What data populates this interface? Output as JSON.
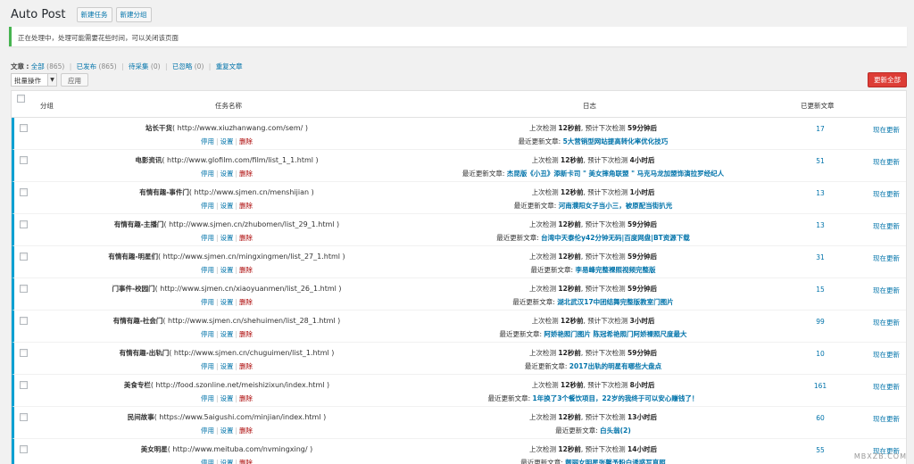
{
  "header": {
    "title": "Auto Post",
    "new_task": "新建任务",
    "new_group": "新建分组"
  },
  "notice": "正在处理中，处理可能需要花些时间，可以关闭该页面",
  "filters": {
    "label": "文章",
    "all": "全部",
    "all_count": "(865)",
    "published": "已发布",
    "published_count": "(865)",
    "pending": "待采集",
    "pending_count": "(0)",
    "ignored": "已忽略",
    "ignored_count": "(0)",
    "duplicate": "重复文章"
  },
  "bulk": {
    "selected": "批量操作",
    "apply": "应用",
    "update_all": "更新全部"
  },
  "columns": {
    "group": "分组",
    "task_name": "任务名称",
    "log": "日志",
    "updated": "已更新文章"
  },
  "row_actions": {
    "stop": "停用",
    "settings": "设置",
    "delete": "删除"
  },
  "log_labels": {
    "last_check": "上次检测",
    "next_check": "预计下次检测",
    "latest": "最近更新文章:"
  },
  "update_now": "现在更新",
  "rows": [
    {
      "name": "站长干货",
      "url": "( http://www.xiuzhanwang.com/sem/ )",
      "last": "12秒前",
      "next": "59分钟后",
      "latest": "5大营销型网站提高转化率优化技巧",
      "count": "17"
    },
    {
      "name": "电影资讯",
      "url": "( http://www.glofilm.com/film/list_1_1.html )",
      "last": "12秒前",
      "next": "4小时后",
      "latest": "杰昆版《小丑》添新卡司 \" 美女摔角联盟 \" 马克马龙加盟饰演拉罗经纪人",
      "count": "51"
    },
    {
      "name": "有情有趣-事件门",
      "url": "( http://www.sjmen.cn/menshijian )",
      "last": "12秒前",
      "next": "1小时后",
      "latest": "河南濮阳女子当小三，被原配当街扒光",
      "count": "13"
    },
    {
      "name": "有情有趣-主播门",
      "url": "( http://www.sjmen.cn/zhubomen/list_29_1.html )",
      "last": "12秒前",
      "next": "59分钟后",
      "latest": "台湾中天泰伦y42分钟无码|百度网盘|BT资源下载",
      "count": "13"
    },
    {
      "name": "有情有趣-明星们",
      "url": "( http://www.sjmen.cn/mingxingmen/list_27_1.html )",
      "last": "12秒前",
      "next": "59分钟后",
      "latest": "李易峰完整裸照视频完整版",
      "count": "31"
    },
    {
      "name": "门事件-校园门",
      "url": "( http://www.sjmen.cn/xiaoyuanmen/list_26_1.html )",
      "last": "12秒前",
      "next": "59分钟后",
      "latest": "湖北武汉17中团结舞完整版教室门图片",
      "count": "15"
    },
    {
      "name": "有情有趣-社会门",
      "url": "( http://www.sjmen.cn/shehuimen/list_28_1.html )",
      "last": "12秒前",
      "next": "3小时后",
      "latest": "阿娇艳照门图片 陈冠希艳照门阿娇裸照尺度最大",
      "count": "99"
    },
    {
      "name": "有情有趣-出轨门",
      "url": "( http://www.sjmen.cn/chuguimen/list_1.html )",
      "last": "12秒前",
      "next": "59分钟后",
      "latest": "2017出轨的明星有哪些大盘点",
      "count": "10"
    },
    {
      "name": "美食专栏",
      "url": "( http://food.szonline.net/meishizixun/index.html )",
      "last": "12秒前",
      "next": "8小时后",
      "latest": "1年换了3个餐饮项目，22岁的我终于可以安心赚钱了！",
      "count": "161"
    },
    {
      "name": "民间故事",
      "url": "( https://www.5aigushi.com/minjian/index.html )",
      "last": "12秒前",
      "next": "13小时后",
      "latest": "白头翁(2)",
      "count": "60"
    },
    {
      "name": "美女明星",
      "url": "( http://www.meituba.com/nvmingxing/ )",
      "last": "12秒前",
      "next": "14小时后",
      "latest": "靓丽女明星张馨予粉白诱惑写真照",
      "count": "55"
    }
  ],
  "watermark": "MBXZB.COM"
}
